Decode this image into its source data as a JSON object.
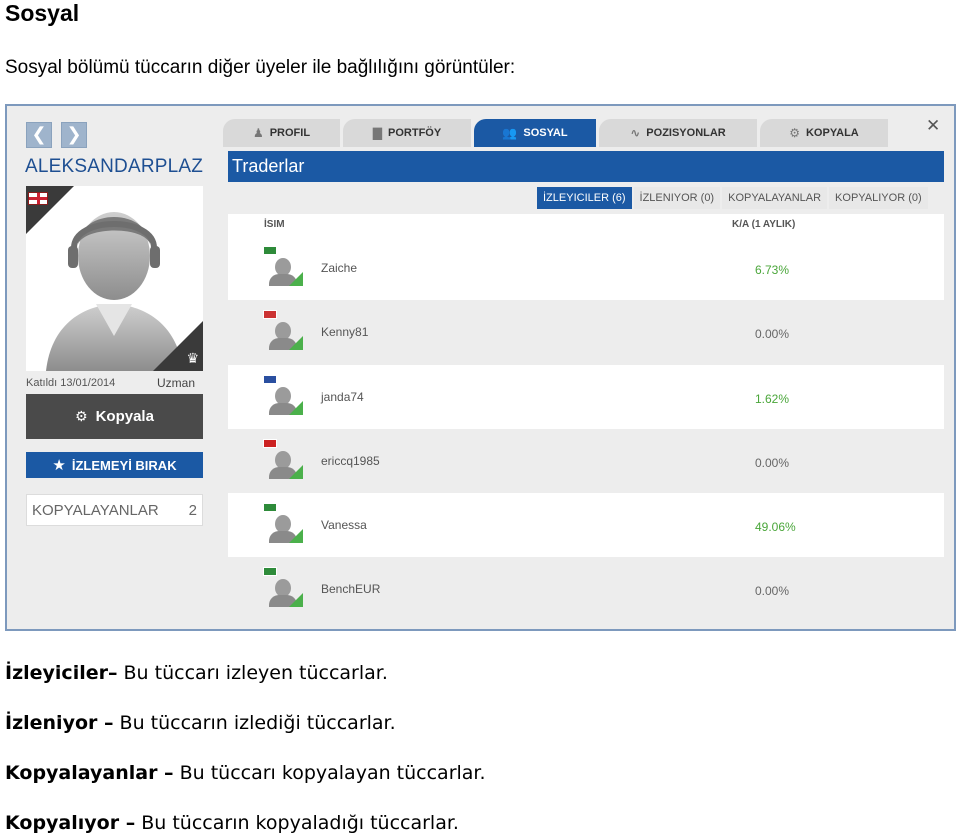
{
  "doc": {
    "title": "Sosyal",
    "intro": "Sosyal bölümü tüccarın diğer üyeler ile bağlılığını görüntüler:"
  },
  "profile": {
    "back_arrow": "❮",
    "forward_arrow": "❯",
    "username": "ALEKSANDARPLAZ",
    "joined": "Katıldı 13/01/2014",
    "level": "Uzman",
    "copy_label": "Kopyala",
    "unwatch_label": "İZLEMEYİ BIRAK",
    "copiers_label": "KOPYALAYANLAR",
    "copiers_count": "2"
  },
  "tabs": [
    {
      "label": "PROFIL",
      "icon": "pawn-icon"
    },
    {
      "label": "PORTFÖY",
      "icon": "bars-icon"
    },
    {
      "label": "SOSYAL",
      "icon": "people-icon",
      "active": true
    },
    {
      "label": "POZISYONLAR",
      "icon": "chart-icon"
    },
    {
      "label": "KOPYALA",
      "icon": "copy-icon"
    }
  ],
  "close_label": "✕",
  "traders": {
    "header": "Traderlar",
    "subtabs": [
      {
        "label": "İZLEYICILER (6)",
        "active": true
      },
      {
        "label": "İZLENIYOR (0)"
      },
      {
        "label": "KOPYALAYANLAR"
      },
      {
        "label": "KOPYALIYOR (0)"
      }
    ],
    "col_name": "İSIM",
    "col_ka": "K/A (1 AYLIK)",
    "rows": [
      {
        "name": "Zaiche",
        "value": "6.73%",
        "value_color": "#4aa63a",
        "flag": "#2e8b3a"
      },
      {
        "name": "Kenny81",
        "value": "0.00%",
        "value_color": "#666666",
        "flag": "#cc3333"
      },
      {
        "name": "janda74",
        "value": "1.62%",
        "value_color": "#4aa63a",
        "flag": "#2a4fa0"
      },
      {
        "name": "ericcq1985",
        "value": "0.00%",
        "value_color": "#666666",
        "flag": "#cc2222"
      },
      {
        "name": "Vanessa",
        "value": "49.06%",
        "value_color": "#4aa63a",
        "flag": "#2e8b3a"
      },
      {
        "name": "BenchEUR",
        "value": "0.00%",
        "value_color": "#666666",
        "flag": "#2e8b3a"
      }
    ]
  },
  "legend": [
    {
      "term": "İzleyiciler–",
      "desc": " Bu tüccarı izleyen tüccarlar."
    },
    {
      "term": "İzleniyor –",
      "desc": " Bu tüccarın izlediği tüccarlar."
    },
    {
      "term": "Kopyalayanlar –",
      "desc": " Bu tüccarı kopyalayan tüccarlar."
    },
    {
      "term": "Kopyalıyor –",
      "desc": " Bu tüccarın kopyaladığı tüccarlar."
    }
  ]
}
